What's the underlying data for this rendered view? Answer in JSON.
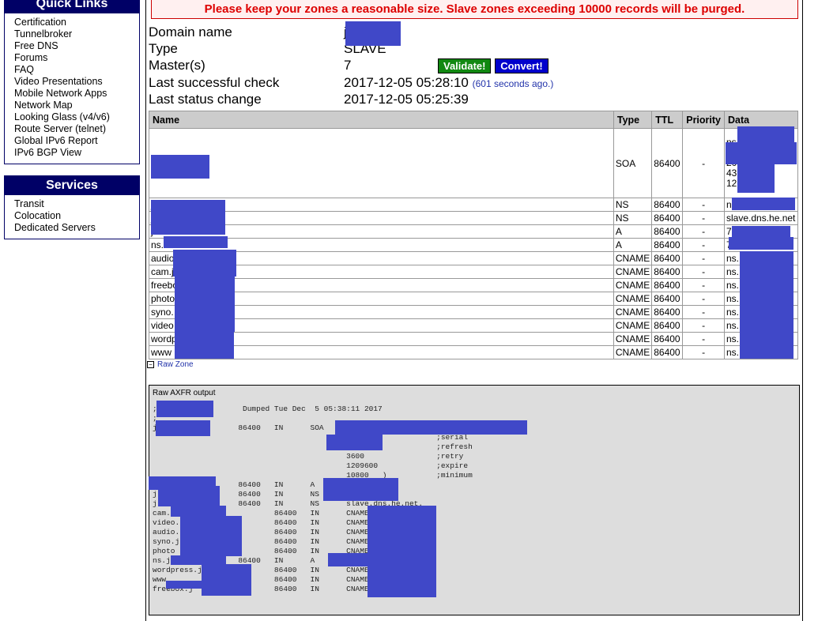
{
  "sidebar": {
    "quick_links": {
      "title": "Quick Links",
      "items": [
        "Certification",
        "Tunnelbroker",
        "Free DNS",
        "Forums",
        "FAQ",
        "Video Presentations",
        "Mobile Network Apps",
        "Network Map",
        "Looking Glass (v4/v6)",
        "Route Server (telnet)",
        "Global IPv6 Report",
        "IPv6 BGP View"
      ]
    },
    "services": {
      "title": "Services",
      "items": [
        "Transit",
        "Colocation",
        "Dedicated Servers"
      ]
    }
  },
  "warning": "Please keep your zones a reasonable size. Slave zones exceeding 10000 records will be purged.",
  "info": {
    "domain_label": "Domain name",
    "domain_value": "j",
    "type_label": "Type",
    "type_value": "SLAVE",
    "masters_label": "Master(s)",
    "masters_value": "7",
    "validate_label": "Validate!",
    "convert_label": "Convert!",
    "last_check_label": "Last successful check",
    "last_check_value": "2017-12-05 05:28:10",
    "last_check_ago": "(601 seconds ago.)",
    "last_change_label": "Last status change",
    "last_change_value": "2017-12-05 05:25:39"
  },
  "colors": {
    "validate": "#118811",
    "convert": "#0000cc",
    "warning": "#dd0000",
    "header": "#000066"
  },
  "table": {
    "columns": [
      "Name",
      "Type",
      "TTL",
      "Priority",
      "Data"
    ],
    "rows": [
      {
        "name": "",
        "type": "SOA",
        "ttl": "86400",
        "priority": "-",
        "data": [
          "ns.",
          "",
          "20",
          "43",
          "12"
        ]
      },
      {
        "name": "j",
        "type": "NS",
        "ttl": "86400",
        "priority": "-",
        "data": [
          "ns."
        ]
      },
      {
        "name": "j",
        "type": "NS",
        "ttl": "86400",
        "priority": "-",
        "data": [
          "slave.dns.he.net"
        ]
      },
      {
        "name": "j",
        "type": "A",
        "ttl": "86400",
        "priority": "-",
        "data": [
          "7"
        ]
      },
      {
        "name": "ns.",
        "type": "A",
        "ttl": "86400",
        "priority": "-",
        "data": [
          "7"
        ]
      },
      {
        "name": "audio",
        "type": "CNAME",
        "ttl": "86400",
        "priority": "-",
        "data": [
          "ns."
        ]
      },
      {
        "name": "cam.j",
        "type": "CNAME",
        "ttl": "86400",
        "priority": "-",
        "data": [
          "ns."
        ]
      },
      {
        "name": "freebox.j",
        "type": "CNAME",
        "ttl": "86400",
        "priority": "-",
        "data": [
          "ns."
        ]
      },
      {
        "name": "photo",
        "type": "CNAME",
        "ttl": "86400",
        "priority": "-",
        "data": [
          "ns."
        ]
      },
      {
        "name": "syno.",
        "type": "CNAME",
        "ttl": "86400",
        "priority": "-",
        "data": [
          "ns."
        ]
      },
      {
        "name": "video",
        "type": "CNAME",
        "ttl": "86400",
        "priority": "-",
        "data": [
          "ns."
        ]
      },
      {
        "name": "wordpress.",
        "type": "CNAME",
        "ttl": "86400",
        "priority": "-",
        "data": [
          "ns."
        ]
      },
      {
        "name": "www",
        "type": "CNAME",
        "ttl": "86400",
        "priority": "-",
        "data": [
          "ns."
        ]
      }
    ]
  },
  "raw_zone": {
    "link": "Raw Zone",
    "title": "Raw AXFR output",
    "lines": [
      "; j                 Dumped Tue Dec  5 05:38:11 2017",
      ";",
      "j                  86400   IN      SOA     ns.",
      "                                           201                 ;serial",
      "                                                               ;refresh",
      "                                           3600                ;retry",
      "                                           1209600             ;expire",
      "                                           10800   )           ;minimum",
      "                   86400   IN      A",
      "j                  86400   IN      NS      ns.j",
      "j                  86400   IN      NS      slave.dns.he.net.",
      "cam.j                      86400   IN      CNAME   ns",
      "video.                     86400   IN      CNAME   ns",
      "audio.                     86400   IN      CNAME   ns",
      "syno.j                     86400   IN      CNAME   ns",
      "photo                      86400   IN      CNAME   ns",
      "ns.j               86400   IN      A       7",
      "wordpress.j                86400   IN      CNAME   ns",
      "www                        86400   IN      CNAME   ns",
      "freebox.j                  86400   IN      CNAME   ns"
    ]
  }
}
